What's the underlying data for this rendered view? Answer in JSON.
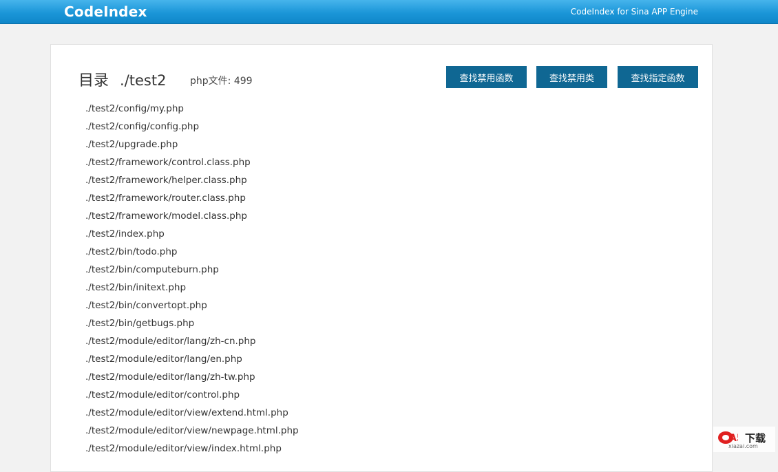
{
  "header": {
    "brand": "CodeIndex",
    "tagline": "CodeIndex for Sina APP Engine",
    "color_top": "#46b4ec",
    "color_bottom": "#0f86c9"
  },
  "panel": {
    "title_label": "目录",
    "title_path": "./test2",
    "php_count": "php文件: 499",
    "buttons": {
      "find_banned_functions": "查找禁用函数",
      "find_banned_classes": "查找禁用类",
      "find_specified_functions": "查找指定函数"
    },
    "button_color": "#0f6793",
    "files": [
      "./test2/config/my.php",
      "./test2/config/config.php",
      "./test2/upgrade.php",
      "./test2/framework/control.class.php",
      "./test2/framework/helper.class.php",
      "./test2/framework/router.class.php",
      "./test2/framework/model.class.php",
      "./test2/index.php",
      "./test2/bin/todo.php",
      "./test2/bin/computeburn.php",
      "./test2/bin/initext.php",
      "./test2/bin/convertopt.php",
      "./test2/bin/getbugs.php",
      "./test2/module/editor/lang/zh-cn.php",
      "./test2/module/editor/lang/en.php",
      "./test2/module/editor/lang/zh-tw.php",
      "./test2/module/editor/control.php",
      "./test2/module/editor/view/extend.html.php",
      "./test2/module/editor/view/newpage.html.php",
      "./test2/module/editor/view/index.html.php"
    ]
  },
  "watermark": {
    "logo_text": "A5",
    "text": "下载",
    "sub": "xiazai.com"
  }
}
